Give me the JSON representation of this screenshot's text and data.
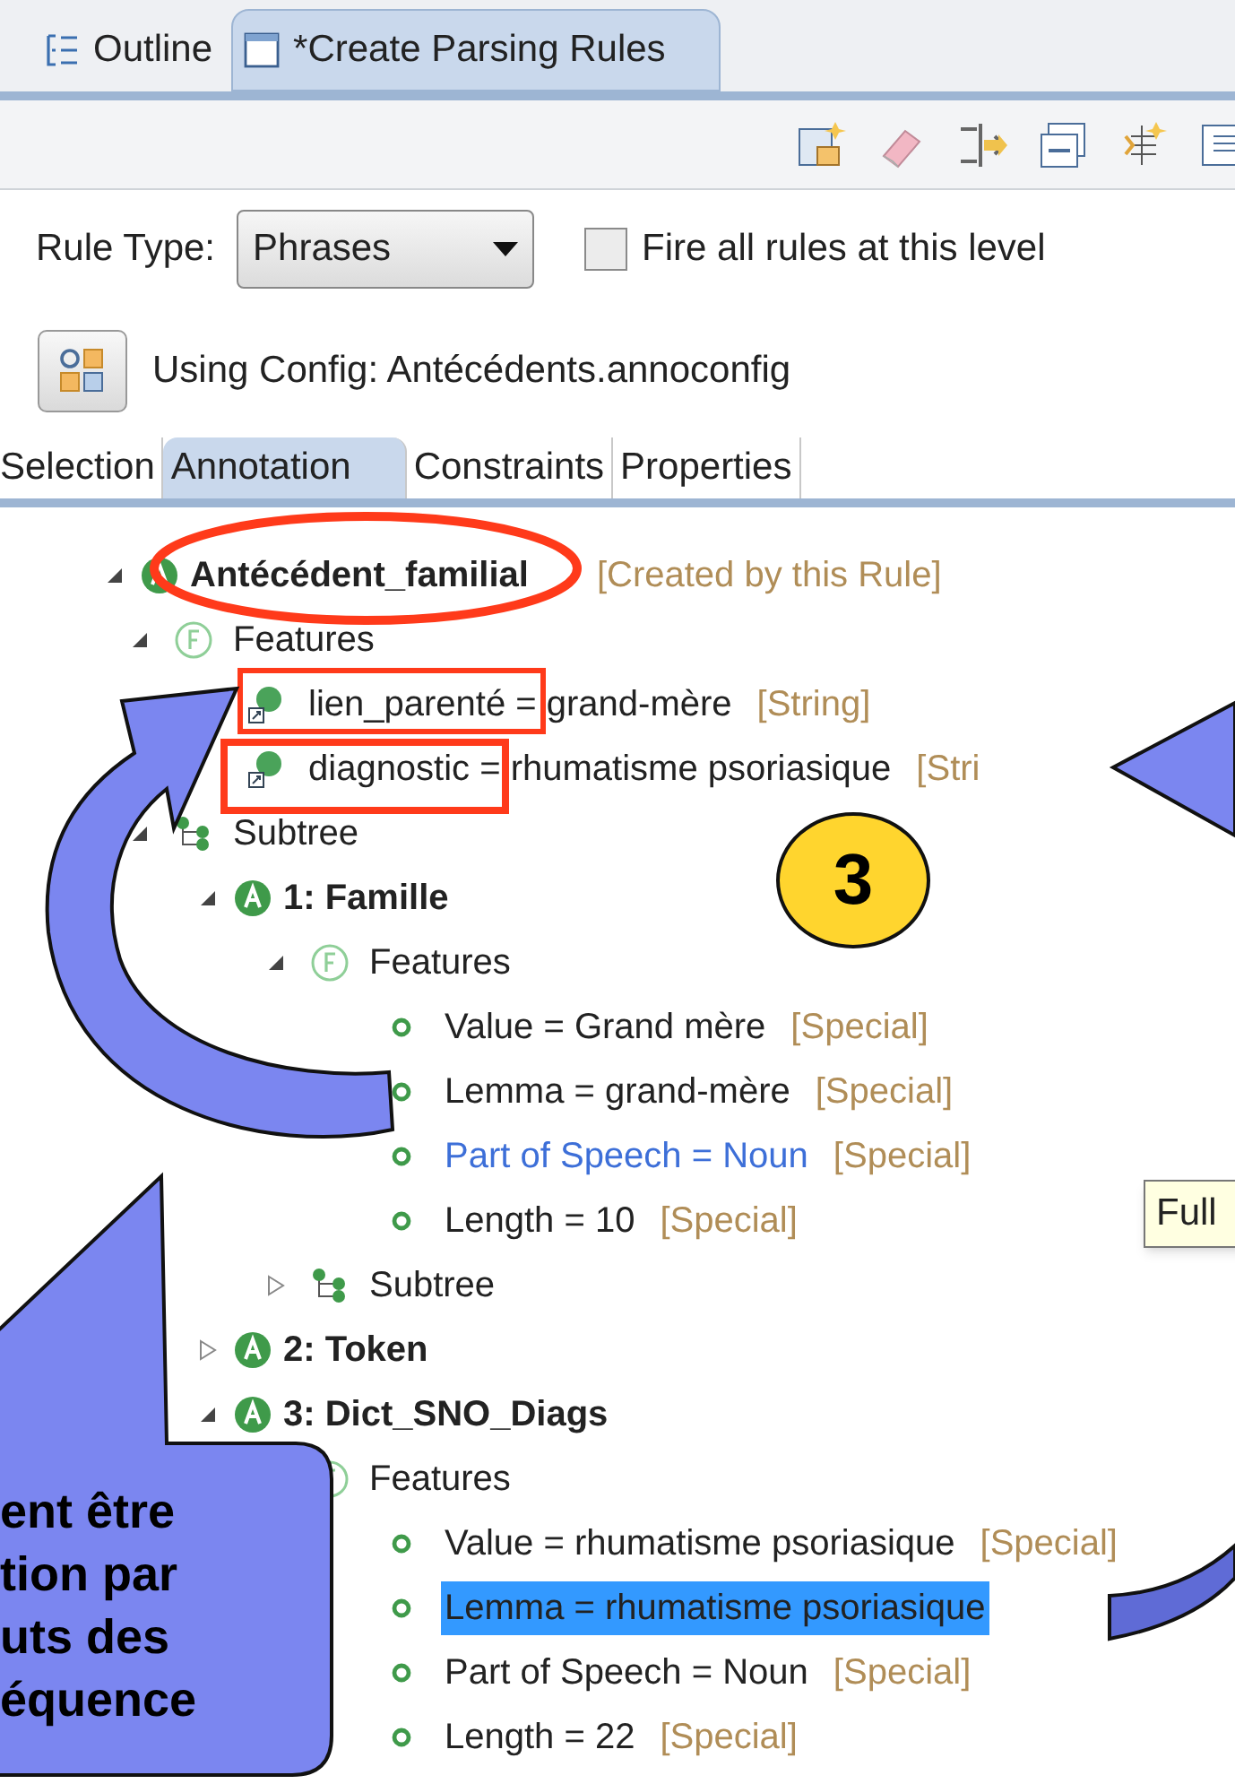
{
  "view_tabs": [
    {
      "label": "Outline",
      "selected": false
    },
    {
      "label": "*Create Parsing Rules",
      "selected": true
    }
  ],
  "rule_type": {
    "label": "Rule Type:",
    "value": "Phrases"
  },
  "fire_all": {
    "label": "Fire all rules at this level",
    "checked": false
  },
  "config": {
    "label": "Using Config: Antécédents.annoconfig"
  },
  "sub_tabs": [
    {
      "label": "Selection",
      "selected": false
    },
    {
      "label": "Annotation",
      "selected": true
    },
    {
      "label": "Constraints",
      "selected": false
    },
    {
      "label": "Properties",
      "selected": false
    }
  ],
  "tree": [
    {
      "kind": "annotation",
      "label": "Antécédent_familial",
      "note": "[Created by this Rule]",
      "expanded": true,
      "selected": false,
      "hovered": false,
      "children": [
        {
          "kind": "features",
          "label": "Features",
          "expanded": true,
          "selected": false,
          "hovered": false,
          "children": [
            {
              "kind": "attribute",
              "label": "lien_parenté = grand-mère",
              "note": "[String]",
              "selected": false,
              "hovered": false
            },
            {
              "kind": "attribute",
              "label": "diagnostic = rhumatisme psoriasique",
              "note": "[Stri",
              "selected": false,
              "hovered": false
            }
          ]
        },
        {
          "kind": "subtree",
          "label": "Subtree",
          "expanded": true,
          "selected": false,
          "hovered": false,
          "children": [
            {
              "kind": "annotation",
              "label": "1: Famille",
              "expanded": true,
              "selected": false,
              "hovered": false,
              "children": [
                {
                  "kind": "features",
                  "label": "Features",
                  "expanded": true,
                  "selected": false,
                  "hovered": false,
                  "children": [
                    {
                      "kind": "value",
                      "label": "Value = Grand mère",
                      "note": "[Special]",
                      "selected": false,
                      "hovered": false
                    },
                    {
                      "kind": "value",
                      "label": "Lemma = grand-mère",
                      "note": "[Special]",
                      "selected": false,
                      "hovered": false
                    },
                    {
                      "kind": "value",
                      "label": "Part of Speech = Noun",
                      "note": "[Special]",
                      "selected": false,
                      "hovered": true
                    },
                    {
                      "kind": "value",
                      "label": "Length = 10",
                      "note": "[Special]",
                      "selected": false,
                      "hovered": false
                    }
                  ]
                },
                {
                  "kind": "subtree",
                  "label": "Subtree",
                  "expanded": false,
                  "selected": false,
                  "hovered": false
                }
              ]
            },
            {
              "kind": "annotation",
              "label": "2: Token",
              "expanded": false,
              "selected": false,
              "hovered": false
            },
            {
              "kind": "annotation",
              "label": "3: Dict_SNO_Diags",
              "expanded": true,
              "selected": false,
              "hovered": false,
              "children": [
                {
                  "kind": "features",
                  "label": "Features",
                  "selected": false,
                  "hovered": false,
                  "children": [
                    {
                      "kind": "value",
                      "label": "Value = rhumatisme psoriasique",
                      "note": "[Special]",
                      "selected": false,
                      "hovered": false
                    },
                    {
                      "kind": "value",
                      "label": "Lemma = rhumatisme psoriasique",
                      "selected": true,
                      "hovered": false
                    },
                    {
                      "kind": "value",
                      "label": "Part of Speech = Noun",
                      "note": "[Special]",
                      "selected": false,
                      "hovered": false
                    },
                    {
                      "kind": "value",
                      "label": "Length = 22",
                      "note": "[Special]",
                      "selected": false,
                      "hovered": false
                    }
                  ]
                }
              ]
            }
          ]
        }
      ]
    }
  ],
  "tooltip": "Full",
  "badge": "3",
  "callout": [
    "ent être",
    "tion par",
    "uts des",
    "équence"
  ]
}
